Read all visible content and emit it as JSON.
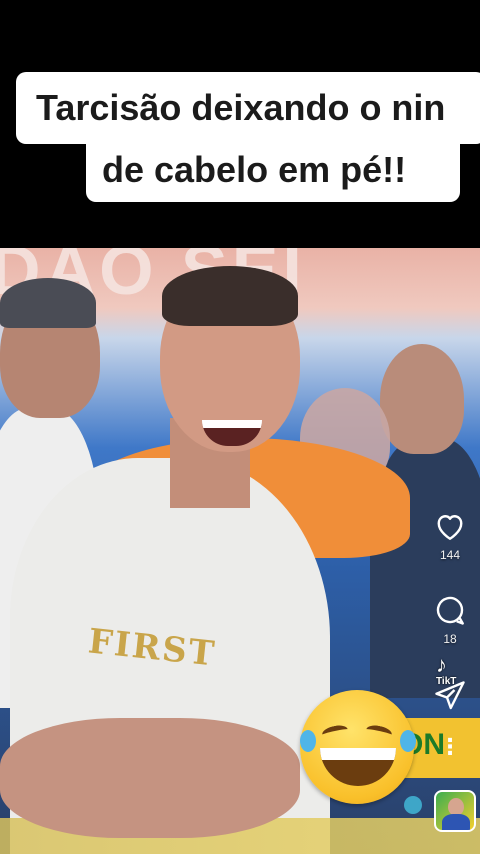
{
  "caption": {
    "line1": "Tarcisão deixando o nin",
    "line2": "de cabelo em pé!!"
  },
  "video": {
    "banner_text": "DÃO SEI",
    "shirt_print": "FIRST",
    "sign_text": "ON",
    "watermark": "TikT"
  },
  "rail": {
    "like": {
      "icon": "heart-outline-icon",
      "count": "144"
    },
    "comment": {
      "icon": "comment-bubble-icon",
      "count": "18"
    },
    "share": {
      "icon": "paper-plane-icon"
    },
    "more": {
      "icon": "more-vertical-icon",
      "label": "⋮"
    }
  },
  "overlay": {
    "emoji": "laughing-tears-emoji"
  },
  "colors": {
    "caption_bg": "#ffffff",
    "caption_text": "#1b1b1b",
    "background": "#000000"
  }
}
